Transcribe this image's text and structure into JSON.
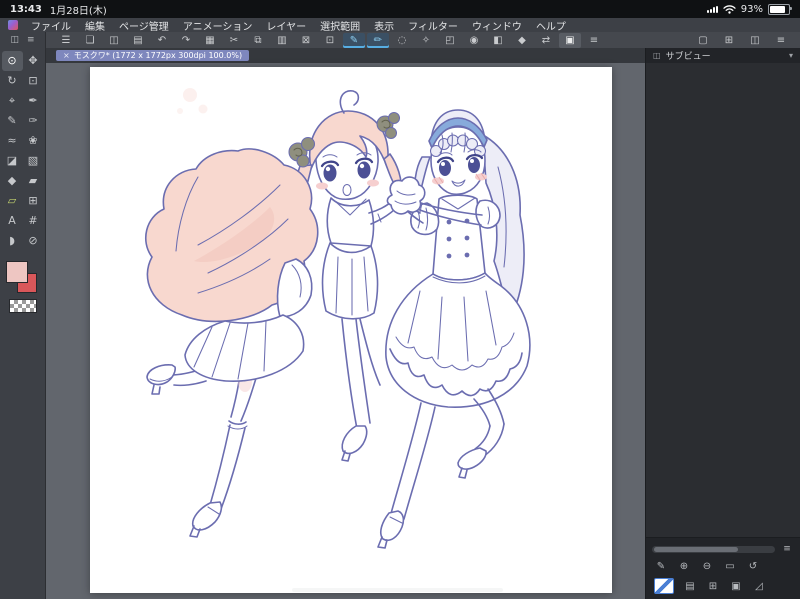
{
  "statusbar": {
    "time": "13:43",
    "date": "1月28日(木)",
    "battery_percent": "93%"
  },
  "menubar": {
    "items": [
      "ファイル",
      "編集",
      "ページ管理",
      "アニメーション",
      "レイヤー",
      "選択範囲",
      "表示",
      "フィルター",
      "ウィンドウ",
      "ヘルプ"
    ]
  },
  "toolbar": {
    "icons": [
      {
        "name": "main-menu",
        "glyph": "☰"
      },
      {
        "name": "page-manager",
        "glyph": "❏"
      },
      {
        "name": "canvas-settings",
        "glyph": "◫"
      },
      {
        "name": "pages",
        "glyph": "▤"
      },
      {
        "name": "undo",
        "glyph": "↶"
      },
      {
        "name": "redo",
        "glyph": "↷"
      },
      {
        "name": "grid",
        "glyph": "▦"
      },
      {
        "name": "cut",
        "glyph": "✂"
      },
      {
        "name": "copy",
        "glyph": "⧉"
      },
      {
        "name": "paste",
        "glyph": "▥"
      },
      {
        "name": "clear",
        "glyph": "⊠"
      },
      {
        "name": "select-rect",
        "glyph": "⊡"
      },
      {
        "name": "pen",
        "glyph": "✎"
      },
      {
        "name": "brush",
        "glyph": "✏"
      },
      {
        "name": "lasso",
        "glyph": "◌"
      },
      {
        "name": "wand",
        "glyph": "✧"
      },
      {
        "name": "transform",
        "glyph": "◰"
      },
      {
        "name": "snap",
        "glyph": "◉"
      },
      {
        "name": "gradient",
        "glyph": "◧"
      },
      {
        "name": "fill",
        "glyph": "◆"
      },
      {
        "name": "flip-view",
        "glyph": "⇄"
      },
      {
        "name": "layer-panel",
        "glyph": "▣"
      },
      {
        "name": "workspace",
        "glyph": "≡"
      }
    ],
    "right_icons": [
      {
        "name": "subview-toggle",
        "glyph": "▢"
      },
      {
        "name": "grid-toggle",
        "glyph": "⊞"
      },
      {
        "name": "panel-layout",
        "glyph": "◫"
      },
      {
        "name": "sidebar-menu",
        "glyph": "≡"
      }
    ]
  },
  "tabbar": {
    "doc_title": "モスクワ* (1772 x 1772px 300dpi 100.0%)",
    "close_glyph": "×"
  },
  "palette": {
    "header_icons": [
      {
        "name": "palette-collapse",
        "glyph": "◫"
      },
      {
        "name": "palette-menu",
        "glyph": "≡"
      }
    ],
    "tools": [
      {
        "name": "zoom",
        "glyph": "⊙"
      },
      {
        "name": "move",
        "glyph": "✥"
      },
      {
        "name": "rotate-canvas",
        "glyph": "↻"
      },
      {
        "name": "selection",
        "glyph": "⊡"
      },
      {
        "name": "eyedropper",
        "glyph": "⌖"
      },
      {
        "name": "pen",
        "glyph": "✒"
      },
      {
        "name": "pencil",
        "glyph": "✎"
      },
      {
        "name": "brush",
        "glyph": "✑"
      },
      {
        "name": "airbrush",
        "glyph": "≈"
      },
      {
        "name": "decoration",
        "glyph": "❀"
      },
      {
        "name": "eraser",
        "glyph": "◪"
      },
      {
        "name": "blend",
        "glyph": "▧"
      },
      {
        "name": "fill",
        "glyph": "◆"
      },
      {
        "name": "gradient",
        "glyph": "▰"
      },
      {
        "name": "figure",
        "glyph": "▱"
      },
      {
        "name": "frame",
        "glyph": "⊞"
      },
      {
        "name": "text",
        "glyph": "A"
      },
      {
        "name": "ruler",
        "glyph": "#"
      },
      {
        "name": "balloon",
        "glyph": "◗"
      },
      {
        "name": "correction",
        "glyph": "⊘"
      }
    ],
    "primary_color": "#eec6c2",
    "secondary_color": "#d9575a"
  },
  "subview": {
    "title": "サブビュー",
    "icon_glyph": "◫",
    "collapse_glyph": "▾"
  },
  "bottom_panel": {
    "menu_glyph": "≡",
    "tool_icons": [
      {
        "name": "pen-small",
        "glyph": "✎"
      },
      {
        "name": "zoom-in",
        "glyph": "⊕"
      },
      {
        "name": "zoom-out",
        "glyph": "⊖"
      },
      {
        "name": "fit-screen",
        "glyph": "▭"
      },
      {
        "name": "reset-view",
        "glyph": "↺"
      }
    ],
    "nav_icons": [
      {
        "name": "layers",
        "glyph": "▤"
      },
      {
        "name": "materials",
        "glyph": "⊞"
      },
      {
        "name": "tool-property",
        "glyph": "▣"
      },
      {
        "name": "resize",
        "glyph": "◿"
      }
    ]
  },
  "artwork": {
    "line_color": "#6b6db0",
    "eye_color": "#4c5095",
    "hair_pink": "#f8d8cf",
    "hair_pink_shadow": "#f2c6bc",
    "hair_lavender": "#ededf7",
    "headband_blue": "#87aadb",
    "blush_pink": "#f6cfcf",
    "flower_gray": "#8f8f7e"
  }
}
